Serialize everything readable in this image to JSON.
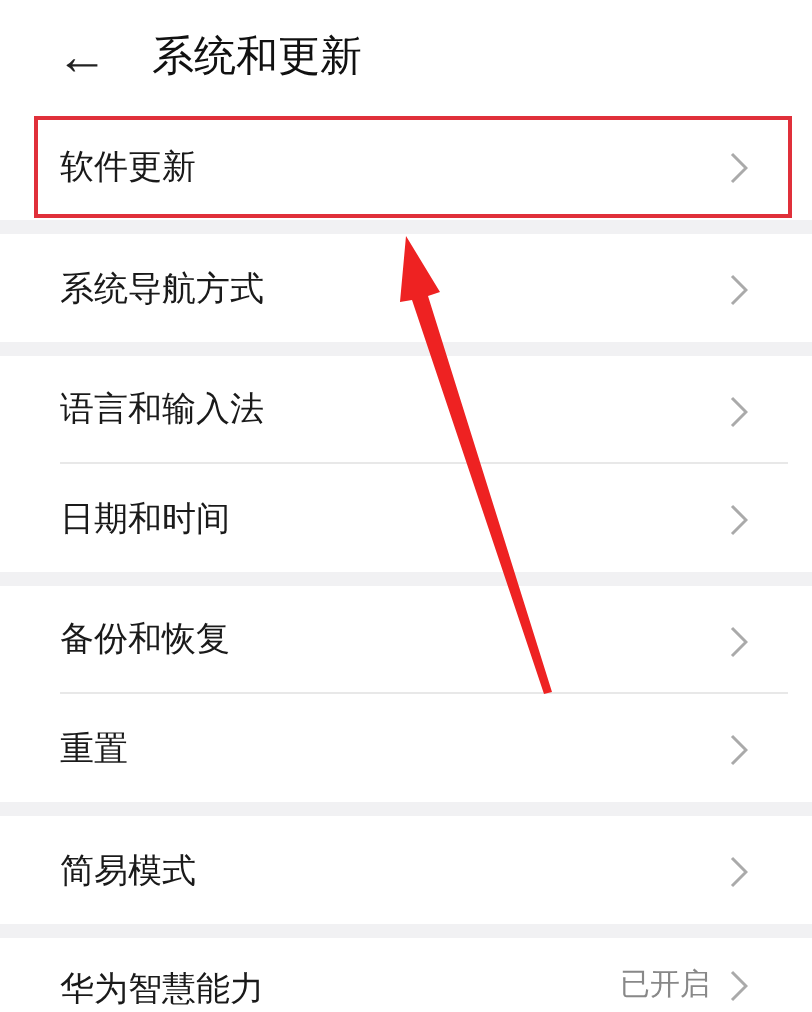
{
  "header": {
    "back": "←",
    "title": "系统和更新"
  },
  "groups": [
    {
      "items": [
        {
          "label": "软件更新",
          "highlighted": true
        }
      ]
    },
    {
      "items": [
        {
          "label": "系统导航方式",
          "highlighted": false
        }
      ]
    },
    {
      "items": [
        {
          "label": "语言和输入法",
          "highlighted": false
        },
        {
          "label": "日期和时间",
          "highlighted": false
        }
      ]
    },
    {
      "items": [
        {
          "label": "备份和恢复",
          "highlighted": false
        },
        {
          "label": "重置",
          "highlighted": false
        }
      ]
    },
    {
      "items": [
        {
          "label": "简易模式",
          "highlighted": false
        }
      ]
    },
    {
      "items": [
        {
          "label": "华为智慧能力",
          "value": "已开启",
          "highlighted": false
        }
      ]
    }
  ]
}
